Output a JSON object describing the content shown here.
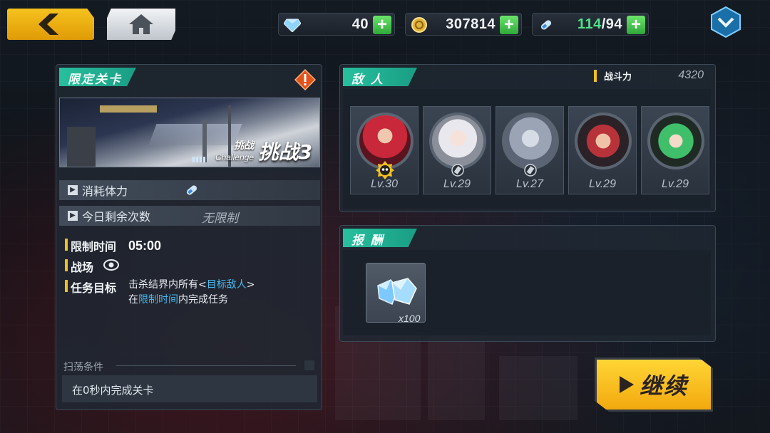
{
  "resources": [
    {
      "icon": "crystal-icon",
      "value": "40"
    },
    {
      "icon": "gold-coin-icon",
      "value": "307814"
    },
    {
      "icon": "stamina-icon",
      "current": "114",
      "sep_max": "/94"
    }
  ],
  "stage": {
    "tag": "限定关卡",
    "title_small": "挑战",
    "title_en": "Challenge",
    "title_big": "挑战3",
    "rows": [
      {
        "label": "消耗体力",
        "value_icon": "stamina-icon"
      },
      {
        "label": "今日剩余次数",
        "value": "无限制"
      }
    ],
    "time_label": "限制时间",
    "time_value": "05:00",
    "field_label": "战场",
    "objective_label": "任务目标",
    "objective_line1_pre": "击杀结界内所有<",
    "objective_line1_hl": "目标敌人",
    "objective_line1_post": ">",
    "objective_line2_pre": "在",
    "objective_line2_hl": "限制时间",
    "objective_line2_post": "内完成任务",
    "sweep_title": "扫荡条件",
    "sweep_text": "在0秒内完成关卡"
  },
  "enemies": {
    "tag": "敌 人",
    "power_label": "战斗力",
    "power_value": "4320",
    "list": [
      {
        "level": "Lv.30",
        "badge": "boss-skull-icon",
        "accent": "#c8283a"
      },
      {
        "level": "Lv.29",
        "badge": "element-icon",
        "accent": "#e8e8ee"
      },
      {
        "level": "Lv.27",
        "badge": "element-icon",
        "accent": "#9aa4b4"
      },
      {
        "level": "Lv.29",
        "badge": "",
        "accent": "#b8323a"
      },
      {
        "level": "Lv.29",
        "badge": "",
        "accent": "#3fbf6a"
      }
    ]
  },
  "reward": {
    "tag": "报 酬",
    "item_icon": "crystal-icon",
    "quantity": "x100"
  },
  "continue_label": "继续",
  "colors": {
    "teal_tag": "#1fb295",
    "gold": "#f3bf1f",
    "highlight_blue": "#46b8ee",
    "green_plus": "#3cbf4a"
  }
}
